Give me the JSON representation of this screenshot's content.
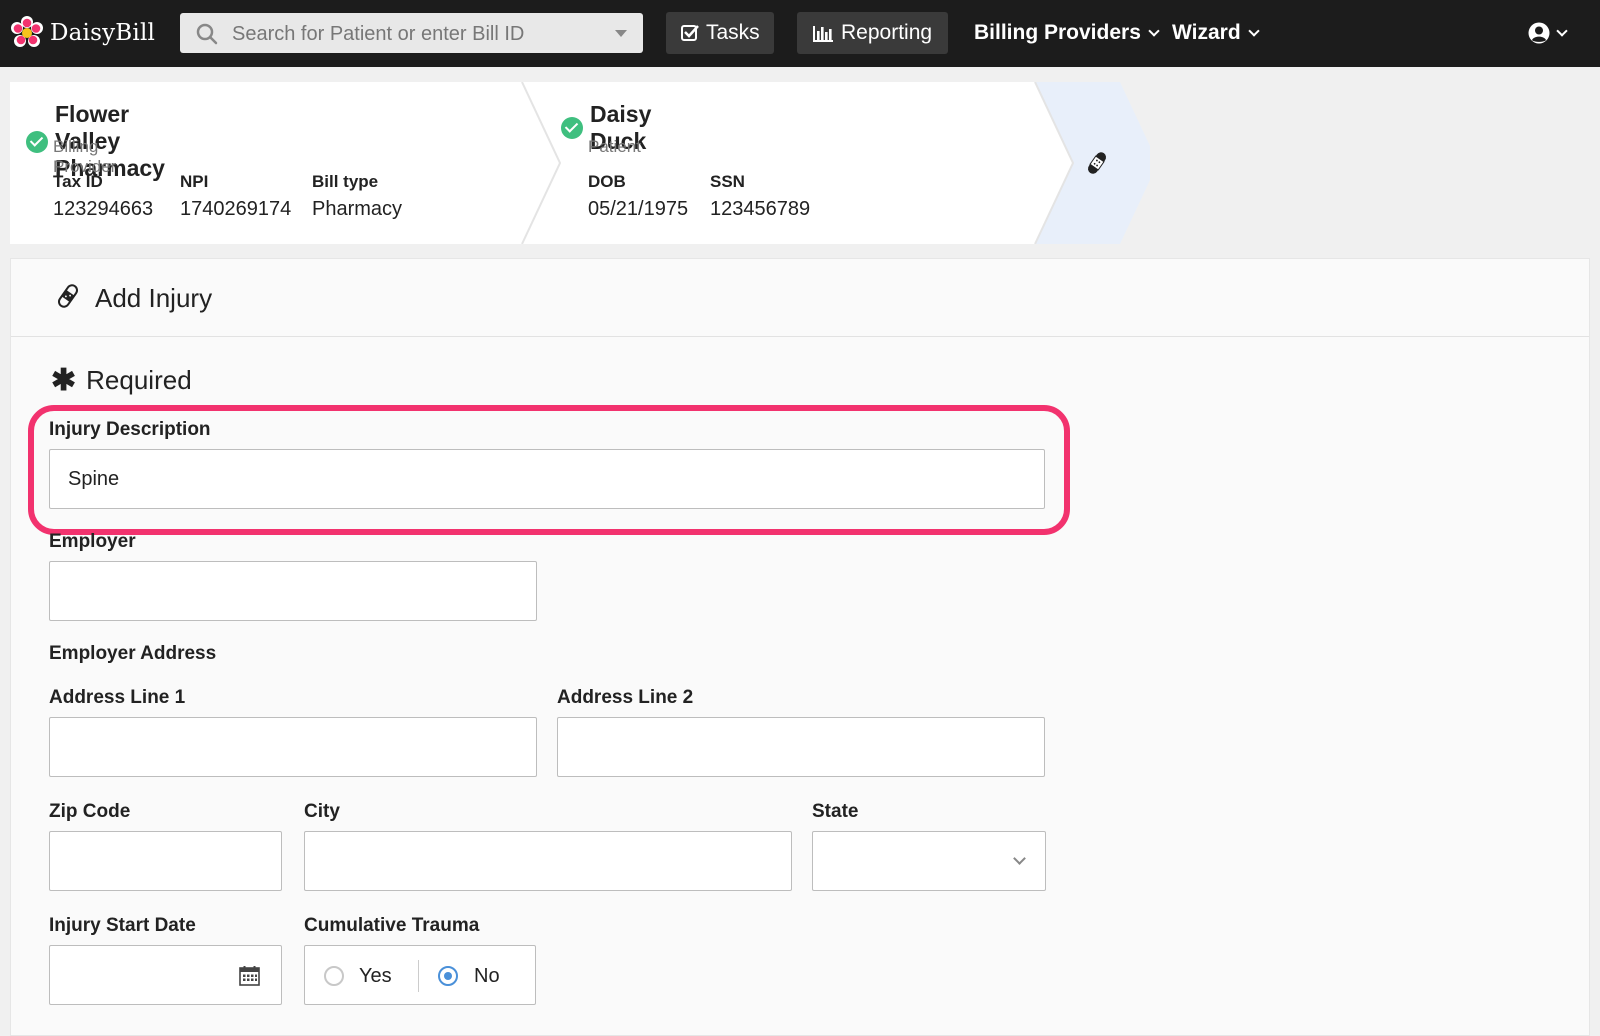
{
  "navbar": {
    "brand": "DaisyBill",
    "search_placeholder": "Search for Patient or enter Bill ID",
    "tasks_label": "Tasks",
    "reporting_label": "Reporting",
    "billing_providers_label": "Billing Providers",
    "wizard_label": "Wizard"
  },
  "breadcrumb": {
    "provider": {
      "name": "Flower Valley Pharmacy",
      "role": "Billing Provider",
      "fields": [
        {
          "label": "Tax ID",
          "value": "123294663"
        },
        {
          "label": "NPI",
          "value": "1740269174"
        },
        {
          "label": "Bill type",
          "value": "Pharmacy"
        }
      ]
    },
    "patient": {
      "name": "Daisy Duck",
      "role": "Patient",
      "fields": [
        {
          "label": "DOB",
          "value": "05/21/1975"
        },
        {
          "label": "SSN",
          "value": "123456789"
        }
      ]
    },
    "current_step_icon": "bandage-icon"
  },
  "form": {
    "title": "Add Injury",
    "required_label": "Required",
    "injury_description": {
      "label": "Injury Description",
      "value": "Spine"
    },
    "employer": {
      "label": "Employer",
      "value": ""
    },
    "employer_address_label": "Employer Address",
    "address_line_1": {
      "label": "Address Line 1",
      "value": ""
    },
    "address_line_2": {
      "label": "Address Line 2",
      "value": ""
    },
    "zip_code": {
      "label": "Zip Code",
      "value": ""
    },
    "city": {
      "label": "City",
      "value": ""
    },
    "state": {
      "label": "State",
      "value": ""
    },
    "injury_start_date": {
      "label": "Injury Start Date",
      "value": ""
    },
    "cumulative_trauma": {
      "label": "Cumulative Trauma",
      "options": [
        "Yes",
        "No"
      ],
      "selected": "No"
    }
  },
  "colors": {
    "navbar": "#1c1c1c",
    "highlight": "#f2326e",
    "check": "#3fbf7f",
    "radio_accent": "#4a90d9"
  }
}
